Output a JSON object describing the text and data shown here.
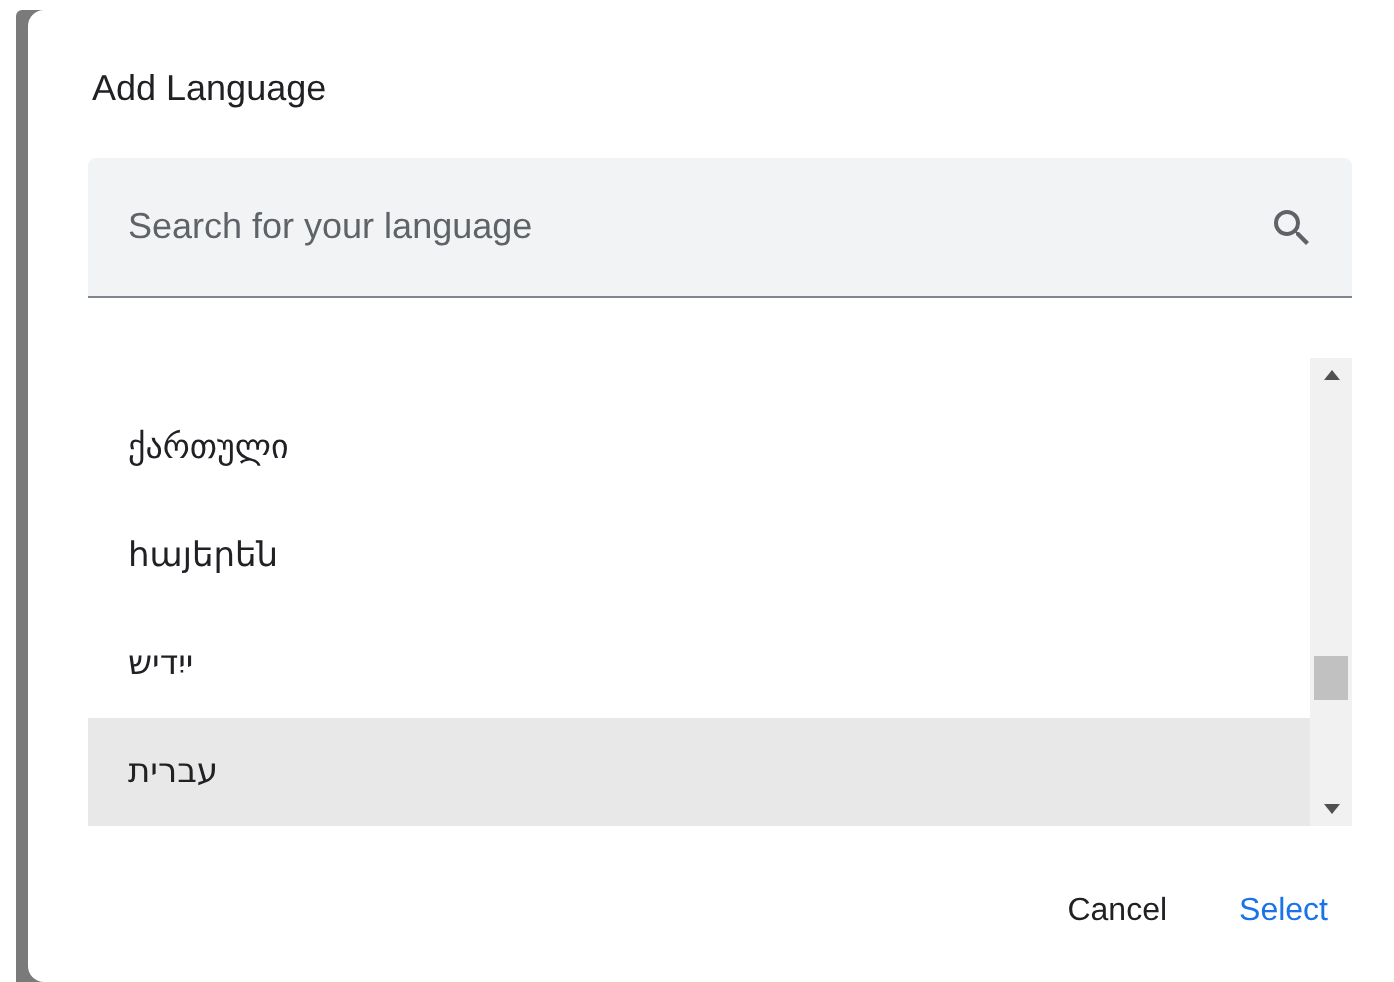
{
  "dialog": {
    "title": "Add Language"
  },
  "search": {
    "placeholder": "Search for your language"
  },
  "languages": [
    {
      "name": "ქართული",
      "selected": false
    },
    {
      "name": "հայերեն",
      "selected": false
    },
    {
      "name": "ייִדיש",
      "selected": false
    },
    {
      "name": "עברית",
      "selected": true
    }
  ],
  "buttons": [
    {
      "label": "Cancel",
      "kind": "text"
    },
    {
      "label": "Select",
      "kind": "primary"
    }
  ]
}
